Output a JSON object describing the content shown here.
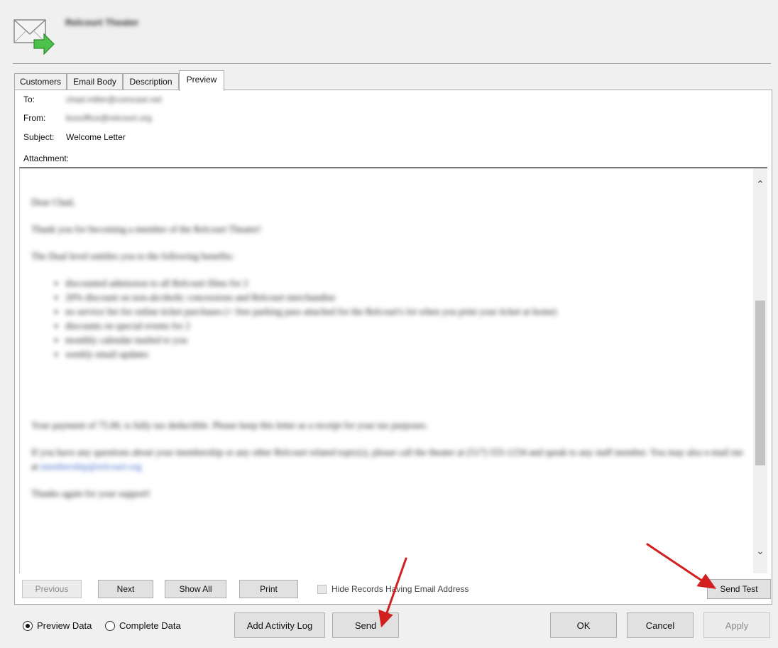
{
  "window": {
    "title": "Relcourt Theater"
  },
  "tabs": [
    {
      "label": "Customers"
    },
    {
      "label": "Email Body"
    },
    {
      "label": "Description"
    },
    {
      "label": "Preview"
    }
  ],
  "header_fields": {
    "to_label": "To:",
    "to_value": "chad.miller@comcast.net",
    "from_label": "From:",
    "from_value": "boxoffice@relcourt.org",
    "subject_label": "Subject:",
    "subject_value": "Welcome Letter",
    "attachment_label": "Attachment:"
  },
  "email": {
    "greeting": "Dear Chad,",
    "intro": "Thank you for becoming a member of the Relcourt Theater!",
    "benefits_intro": "The Dual level entitles you to the following benefits:",
    "benefits": [
      "discounted admission to all Relcourt films for 2",
      "20% discount on non-alcoholic concessions and Relcourt merchandise",
      "no service fee for online ticket purchases (+ free parking pass attached for the Relcourt's lot when you print your ticket at home)",
      "discounts on special events for 2",
      "monthly calendar mailed to you",
      "weekly email updates"
    ],
    "payment": "Your payment of 75.00, is fully tax deductible. Please keep this letter as a receipt for your tax purposes.",
    "questions": "If you have any questions about your membership or any other Relcourt related topic(s), please call the theater at (517) 555-1234 and speak to any staff member. You may also e-mail me at",
    "contact_email": "membership@relcourt.org",
    "closing": "Thanks again for your support!"
  },
  "scrollbar": {
    "up_glyph": "⌃",
    "down_glyph": "⌄"
  },
  "nav_buttons": {
    "previous": "Previous",
    "next": "Next",
    "show_all": "Show All",
    "print": "Print",
    "hide_records": "Hide Records Having Email Address",
    "send_test": "Send Test"
  },
  "footer": {
    "preview_data": "Preview Data",
    "complete_data": "Complete Data",
    "add_activity_log": "Add Activity Log",
    "send": "Send",
    "ok": "OK",
    "cancel": "Cancel",
    "apply": "Apply"
  },
  "colors": {
    "annotation_arrow": "#d21f1f",
    "link": "#3b67c9",
    "icon_arrow": "#4cc24a"
  }
}
